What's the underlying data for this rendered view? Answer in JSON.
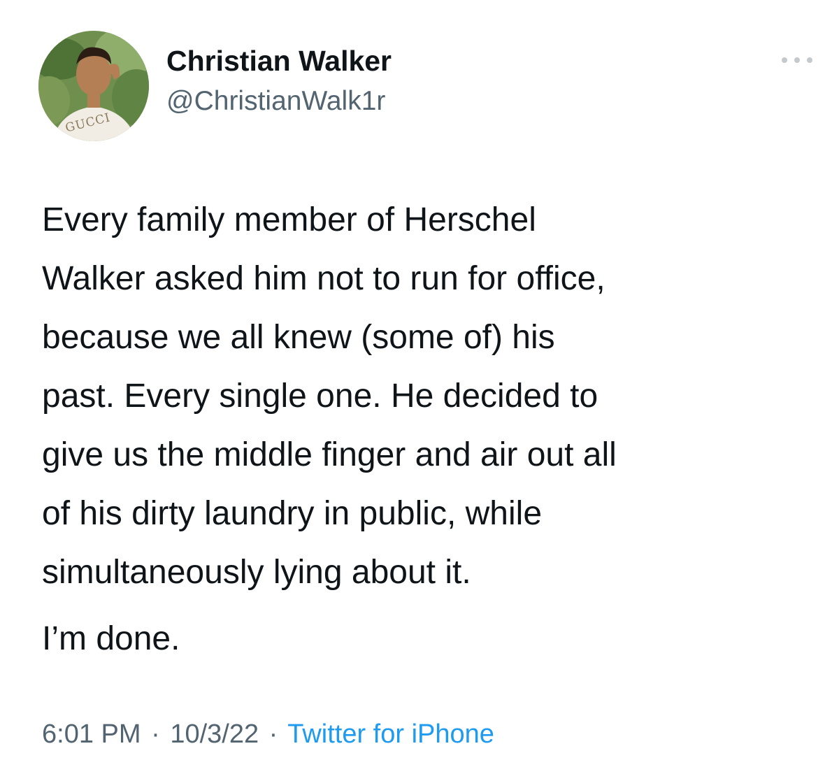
{
  "tweet": {
    "author": {
      "name": "Christian Walker",
      "handle": "@ChristianWalk1r",
      "avatar_shirt_text": "GUCCI"
    },
    "more_icon": "more-options-icon",
    "text_lines": [
      "Every family member of Herschel",
      "Walker asked him not to run for office,",
      "because we all knew (some of) his",
      "past. Every single one. He decided to",
      "give us the middle finger and air out all",
      "of his dirty laundry in public, while",
      "simultaneously lying about it."
    ],
    "closing_line": "I’m done.",
    "meta": {
      "time": "6:01 PM",
      "separator": "·",
      "date": "10/3/22",
      "source": "Twitter for iPhone"
    },
    "colors": {
      "text": "#0f1419",
      "secondary": "#536471",
      "link": "#1d9bf0"
    }
  }
}
